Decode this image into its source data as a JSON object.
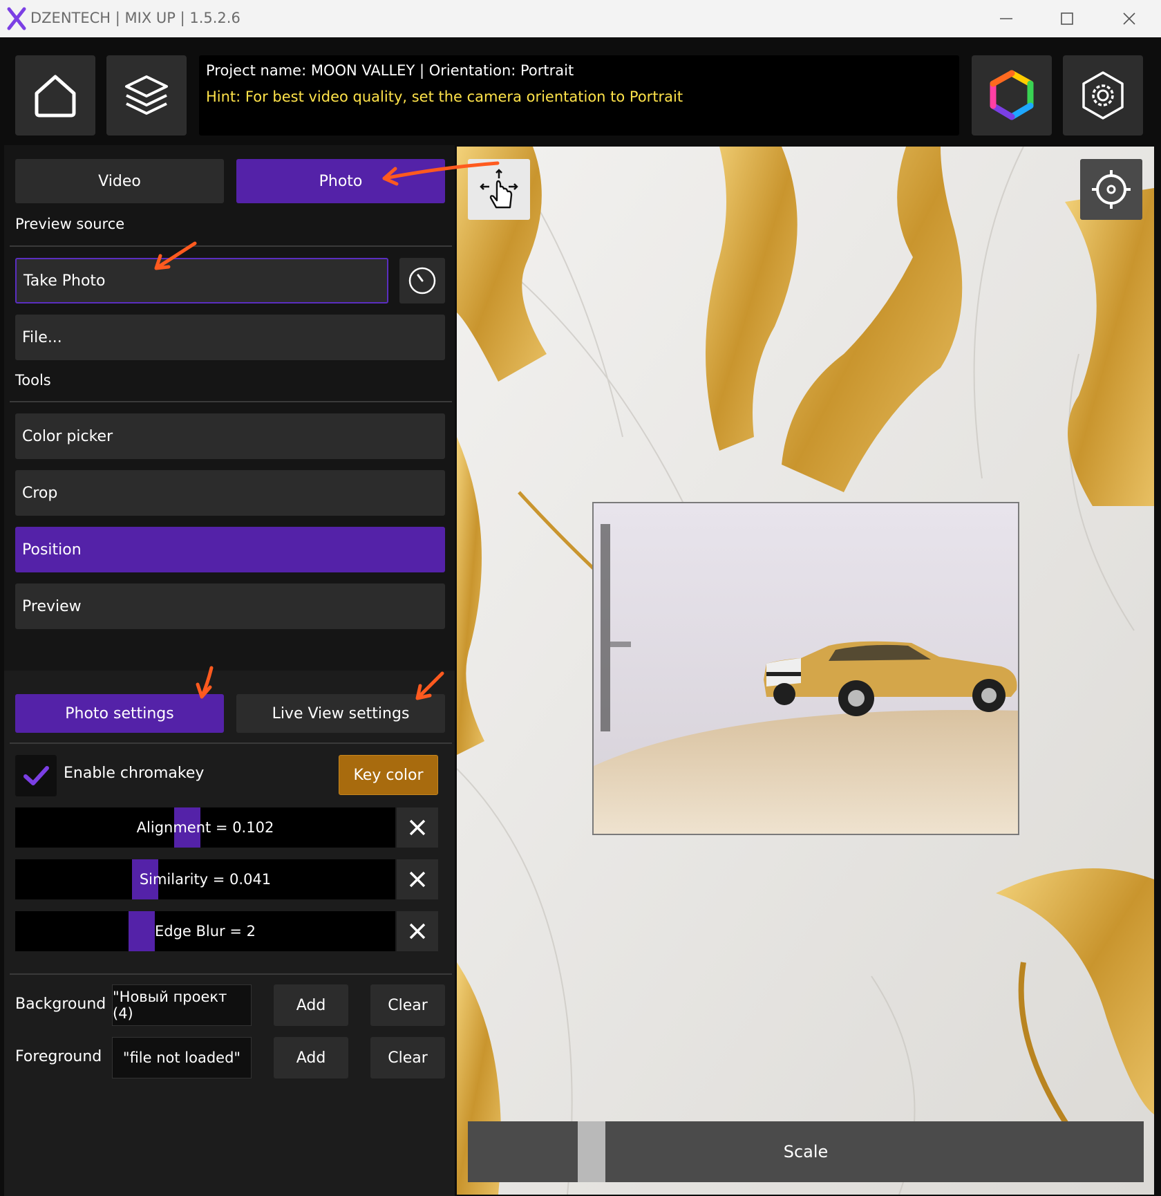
{
  "window": {
    "title": "DZENTECH | MIX UP | 1.5.2.6",
    "logo_glyph": "X",
    "controls": [
      "minimize",
      "maximize",
      "close"
    ]
  },
  "topbar": {
    "project_line": "Project name: MOON VALLEY | Orientation: Portrait",
    "hint_line": "Hint: For best video quality, set the camera orientation to Portrait",
    "hint_color": "#ffe34a"
  },
  "mode_tabs": [
    {
      "label": "Video",
      "active": false
    },
    {
      "label": "Photo",
      "active": true
    }
  ],
  "preview_source": {
    "heading": "Preview source",
    "take_photo": "Take Photo",
    "file": "File..."
  },
  "tools": {
    "heading": "Tools",
    "items": [
      {
        "label": "Color picker",
        "active": false
      },
      {
        "label": "Crop",
        "active": false
      },
      {
        "label": "Position",
        "active": true
      },
      {
        "label": "Preview",
        "active": false
      }
    ]
  },
  "settings_tabs": [
    {
      "label": "Photo settings",
      "active": true
    },
    {
      "label": "Live View settings",
      "active": false
    }
  ],
  "chromakey": {
    "enable_label": "Enable chromakey",
    "enabled": true,
    "key_color_label": "Key color",
    "key_color": "#a86b0e"
  },
  "sliders": [
    {
      "label": "Alignment = 0.102",
      "value_fraction": 0.45
    },
    {
      "label": "Similarity = 0.041",
      "value_fraction": 0.33
    },
    {
      "label": "Edge Blur = 2",
      "value_fraction": 0.32
    }
  ],
  "layers": [
    {
      "label": "Background",
      "value": "\"Новый проект (4)",
      "add": "Add",
      "clear": "Clear"
    },
    {
      "label": "Foreground",
      "value": "\"file not loaded\"",
      "add": "Add",
      "clear": "Clear"
    }
  ],
  "preview": {
    "scale_label": "Scale",
    "scale_fraction": 0.17
  },
  "colors": {
    "accent": "#5422a8",
    "panel": "#151515",
    "button": "#2c2c2c",
    "annotation_arrow": "#ff5a1f"
  }
}
